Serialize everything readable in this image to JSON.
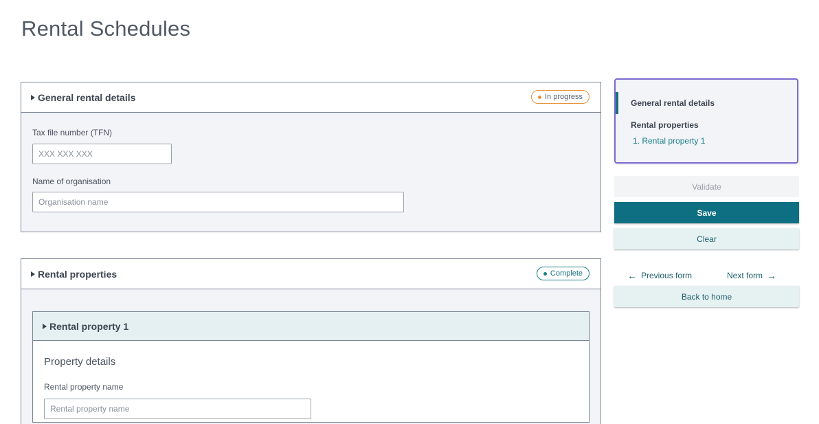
{
  "page": {
    "title": "Rental Schedules"
  },
  "general": {
    "title": "General rental details",
    "status": "In progress",
    "tfn_label": "Tax file number (TFN)",
    "tfn_placeholder": "XXX XXX XXX",
    "org_label": "Name of organisation",
    "org_placeholder": "Organisation name"
  },
  "rental_properties": {
    "title": "Rental properties",
    "status": "Complete",
    "property1": {
      "title": "Rental property 1",
      "section_heading": "Property details",
      "name_label": "Rental property name",
      "name_placeholder": "Rental property name"
    }
  },
  "sidebar": {
    "nav_general": "General rental details",
    "nav_rental_properties": "Rental properties",
    "nav_property1": "1. Rental property 1",
    "validate": "Validate",
    "save": "Save",
    "clear": "Clear",
    "previous": "Previous form",
    "next": "Next form",
    "back_home": "Back to home"
  },
  "colors": {
    "accent": "#0f6f82",
    "in_progress": "#e8913b",
    "complete": "#1a7f8d",
    "focus": "#7c6bd1"
  }
}
